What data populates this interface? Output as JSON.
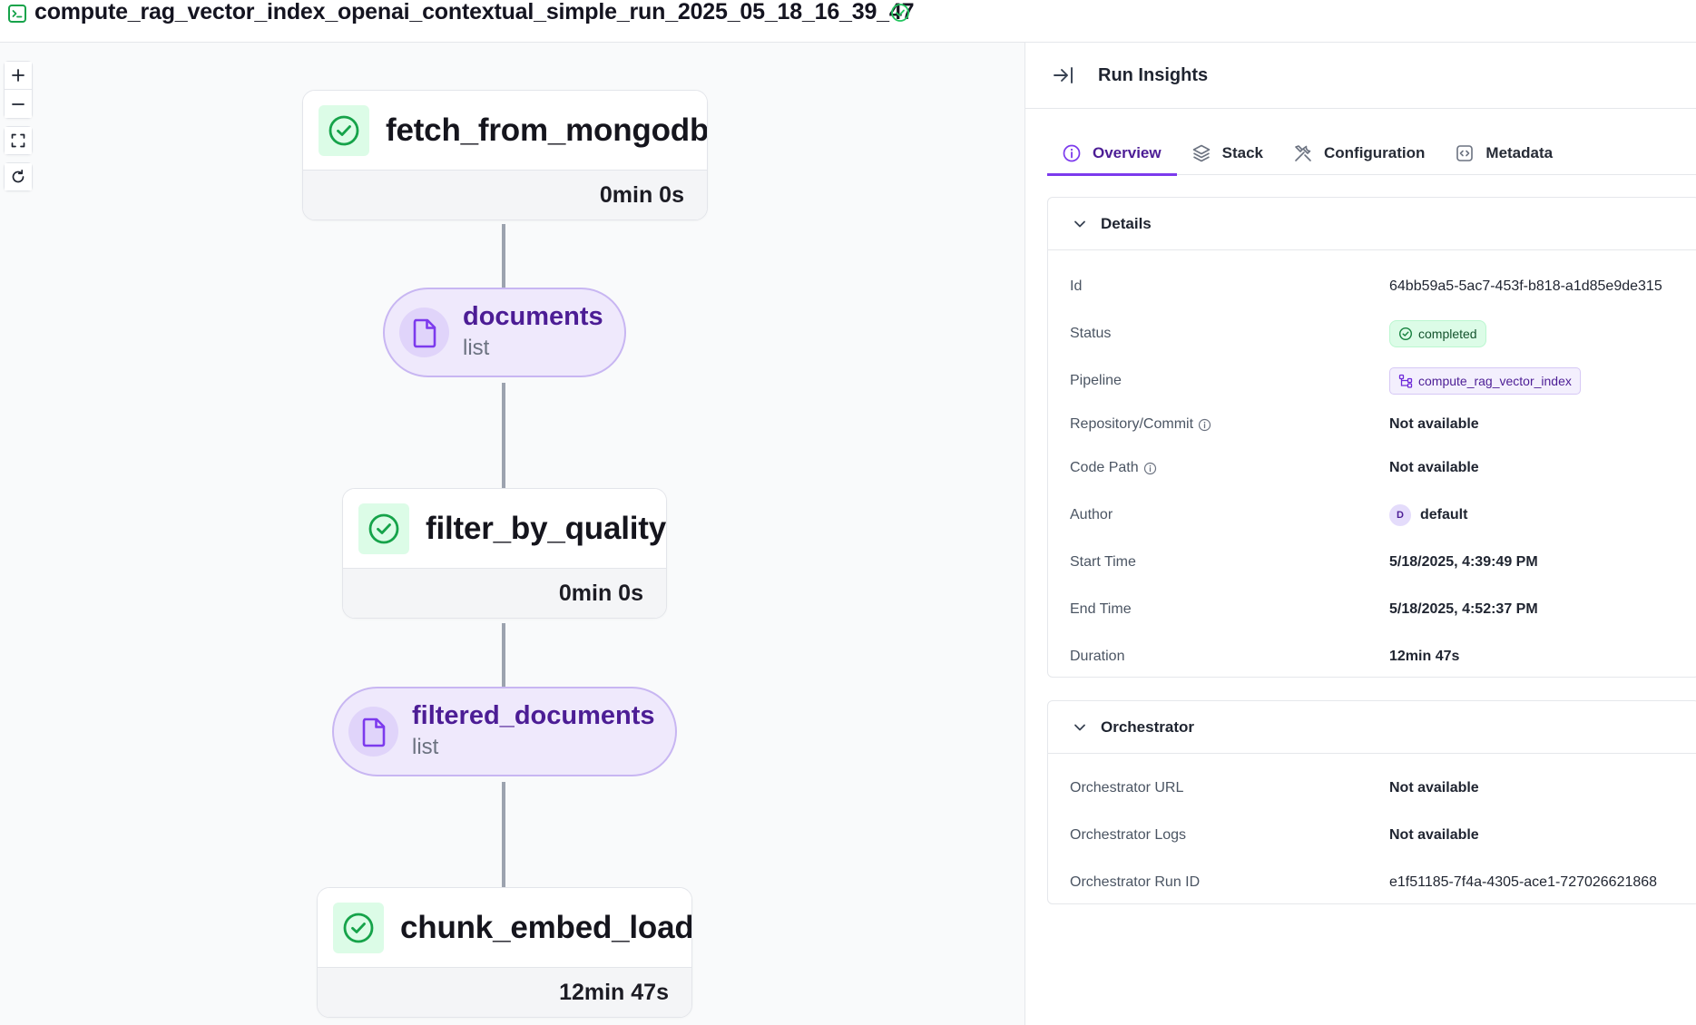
{
  "header": {
    "title": "compute_rag_vector_index_openai_contextual_simple_run_2025_05_18_16_39_47",
    "terminal_icon": "terminal-icon",
    "status_icon": "check-circle-icon",
    "accent_green": "#22c55e"
  },
  "canvas": {
    "controls": [
      "zoom-in-icon",
      "zoom-out-icon",
      "fit-view-icon",
      "refresh-icon"
    ],
    "steps": [
      {
        "name": "fetch_from_mongodb",
        "duration": "0min 0s"
      },
      {
        "name": "filter_by_quality",
        "duration": "0min 0s"
      },
      {
        "name": "chunk_embed_load",
        "duration": "12min 47s"
      }
    ],
    "artifacts": [
      {
        "name": "documents",
        "type": "list"
      },
      {
        "name": "filtered_documents",
        "type": "list"
      }
    ]
  },
  "panel": {
    "title": "Run Insights",
    "tabs": [
      {
        "label": "Overview",
        "icon": "info-icon",
        "active": true
      },
      {
        "label": "Stack",
        "icon": "layers-icon",
        "active": false
      },
      {
        "label": "Configuration",
        "icon": "tools-icon",
        "active": false
      },
      {
        "label": "Metadata",
        "icon": "code-icon",
        "active": false
      }
    ],
    "details": {
      "title": "Details",
      "rows": {
        "id": {
          "label": "Id",
          "value": "64bb59a5-5ac7-453f-b818-a1d85e9de315"
        },
        "status": {
          "label": "Status",
          "value": "completed"
        },
        "pipeline": {
          "label": "Pipeline",
          "value": "compute_rag_vector_index"
        },
        "repo": {
          "label": "Repository/Commit",
          "value": "Not available"
        },
        "code_path": {
          "label": "Code Path",
          "value": "Not available"
        },
        "author": {
          "label": "Author",
          "value": "default",
          "initial": "D"
        },
        "start": {
          "label": "Start Time",
          "value": "5/18/2025, 4:39:49 PM"
        },
        "end": {
          "label": "End Time",
          "value": "5/18/2025, 4:52:37 PM"
        },
        "duration": {
          "label": "Duration",
          "value": "12min 47s"
        }
      }
    },
    "orchestrator": {
      "title": "Orchestrator",
      "rows": {
        "url": {
          "label": "Orchestrator URL",
          "value": "Not available"
        },
        "logs": {
          "label": "Orchestrator Logs",
          "value": "Not available"
        },
        "run_id": {
          "label": "Orchestrator Run ID",
          "value": "e1f51185-7f4a-4305-ace1-727026621868"
        }
      }
    }
  }
}
